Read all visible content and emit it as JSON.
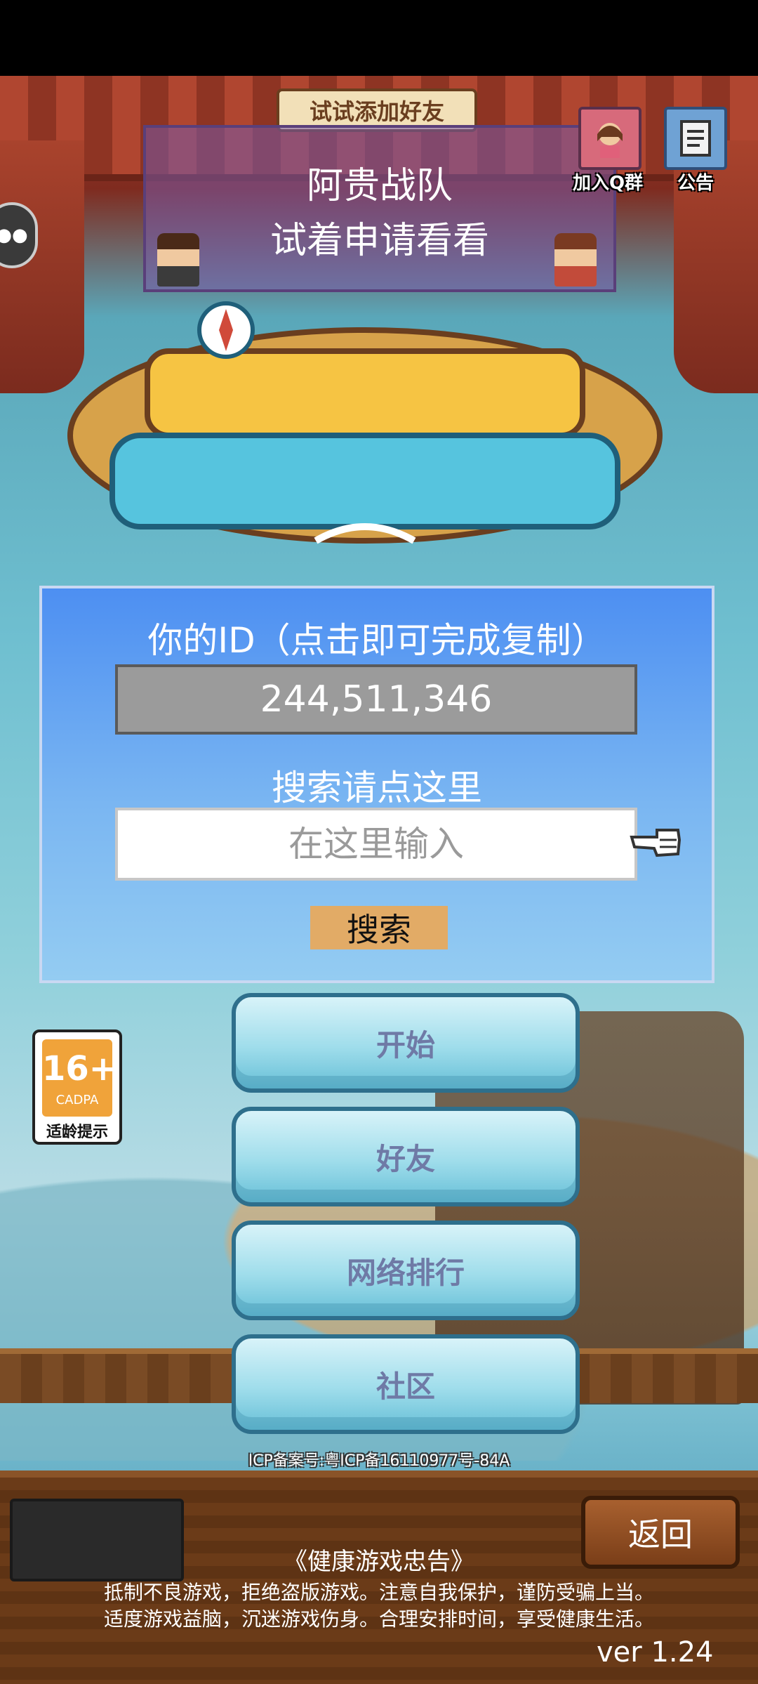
{
  "banner": {
    "tag": "试试添加好友",
    "team_name": "阿贵战队",
    "hint": "试着申请看看"
  },
  "top_buttons": {
    "qq_label": "加入Q群",
    "notice_label": "公告"
  },
  "id_panel": {
    "title": "你的ID（点击即可完成复制）",
    "id_value": "244,511,346",
    "search_title": "搜索请点这里",
    "search_placeholder": "在这里输入",
    "search_button": "搜索"
  },
  "age_badge": {
    "age": "16+",
    "org": "CADPA",
    "label": "适龄提示"
  },
  "menu": {
    "start": "开始",
    "friends": "好友",
    "ranking": "网络排行",
    "community": "社区"
  },
  "footer": {
    "icp": "ICP备案号:粤ICP备16110977号-84A",
    "back": "返回",
    "health_title": "《健康游戏忠告》",
    "health_line1": "抵制不良游戏，拒绝盗版游戏。注意自我保护，谨防受骗上当。",
    "health_line2": "适度游戏益脑，沉迷游戏伤身。合理安排时间，享受健康生活。",
    "version": "ver 1.24"
  }
}
